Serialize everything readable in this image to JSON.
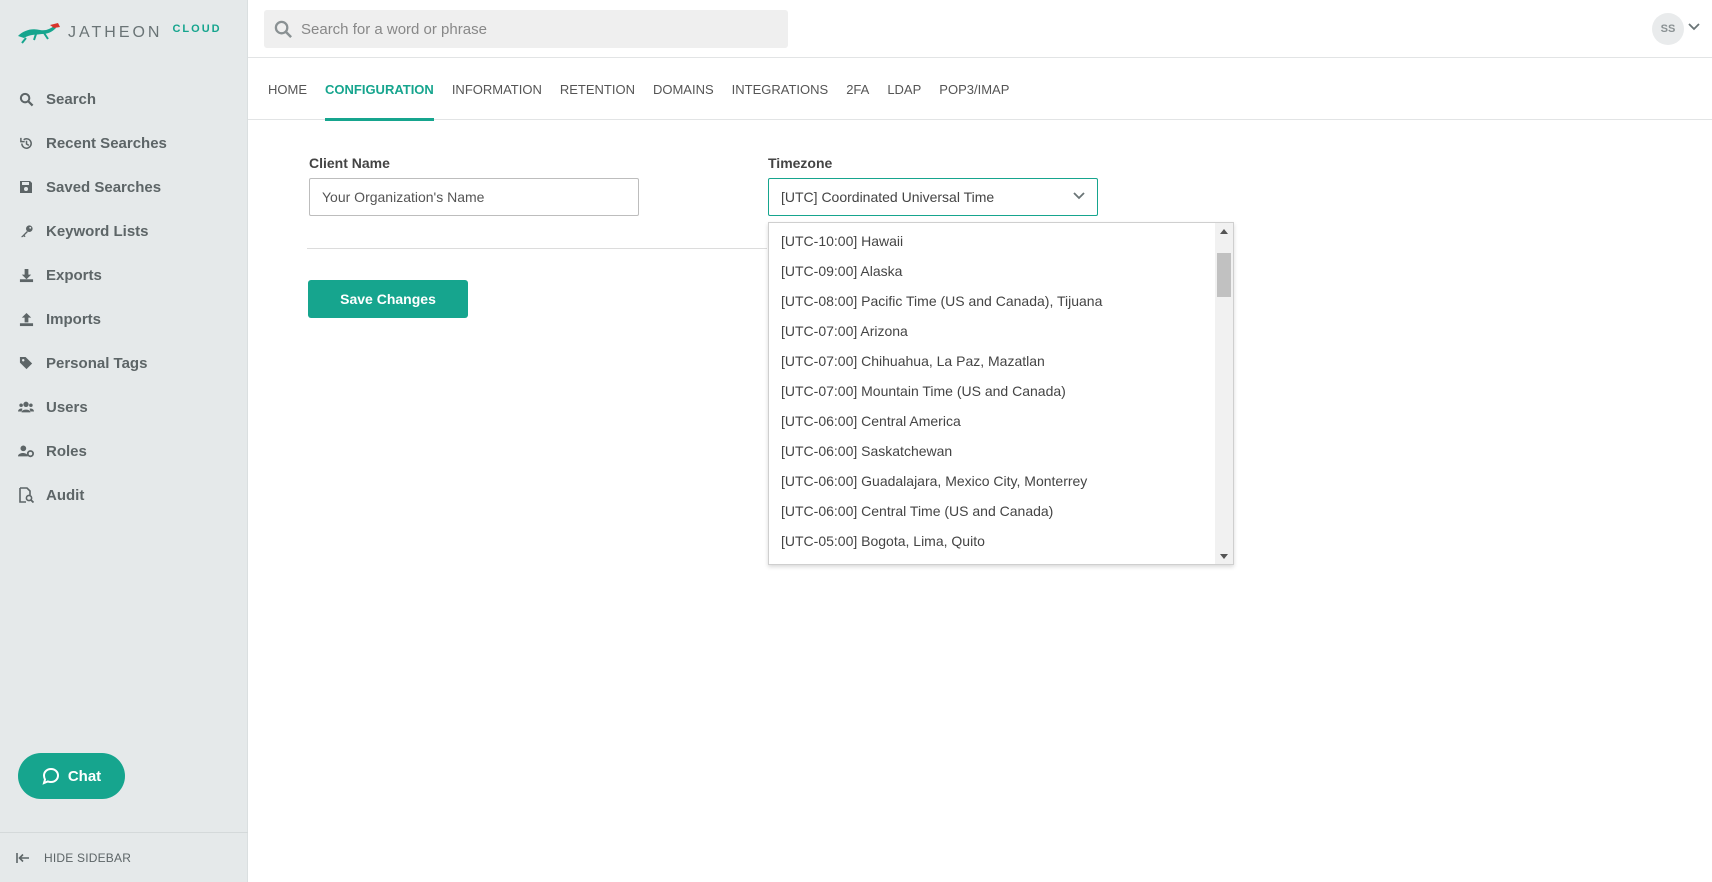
{
  "brand": {
    "name": "JATHEON",
    "suffix": "CLOUD",
    "accent": "#16a58e"
  },
  "sidebar": {
    "items": [
      {
        "label": "Search",
        "icon": "search-icon"
      },
      {
        "label": "Recent Searches",
        "icon": "history-icon"
      },
      {
        "label": "Saved Searches",
        "icon": "floppy-icon"
      },
      {
        "label": "Keyword Lists",
        "icon": "key-icon"
      },
      {
        "label": "Exports",
        "icon": "download-icon"
      },
      {
        "label": "Imports",
        "icon": "upload-icon"
      },
      {
        "label": "Personal Tags",
        "icon": "tags-icon"
      },
      {
        "label": "Users",
        "icon": "users-icon"
      },
      {
        "label": "Roles",
        "icon": "user-cog-icon"
      },
      {
        "label": "Audit",
        "icon": "file-search-icon"
      }
    ],
    "chat_label": "Chat",
    "hide_label": "HIDE SIDEBAR"
  },
  "header": {
    "search_placeholder": "Search for a word or phrase",
    "avatar_initials": "SS"
  },
  "tabs": [
    {
      "label": "HOME",
      "active": false
    },
    {
      "label": "CONFIGURATION",
      "active": true
    },
    {
      "label": "INFORMATION",
      "active": false
    },
    {
      "label": "RETENTION",
      "active": false
    },
    {
      "label": "DOMAINS",
      "active": false
    },
    {
      "label": "INTEGRATIONS",
      "active": false
    },
    {
      "label": "2FA",
      "active": false
    },
    {
      "label": "LDAP",
      "active": false
    },
    {
      "label": "POP3/IMAP",
      "active": false
    }
  ],
  "form": {
    "client_name_label": "Client Name",
    "client_name_placeholder": "Your Organization's Name",
    "timezone_label": "Timezone",
    "timezone_value": "[UTC] Coordinated Universal Time",
    "save_label": "Save Changes"
  },
  "timezone_options": [
    "[UTC-10:00] Hawaii",
    "[UTC-09:00] Alaska",
    "[UTC-08:00] Pacific Time (US and Canada), Tijuana",
    "[UTC-07:00] Arizona",
    "[UTC-07:00] Chihuahua, La Paz, Mazatlan",
    "[UTC-07:00] Mountain Time (US and Canada)",
    "[UTC-06:00] Central America",
    "[UTC-06:00] Saskatchewan",
    "[UTC-06:00] Guadalajara, Mexico City, Monterrey",
    "[UTC-06:00] Central Time (US and Canada)",
    "[UTC-05:00] Bogota, Lima, Quito"
  ]
}
